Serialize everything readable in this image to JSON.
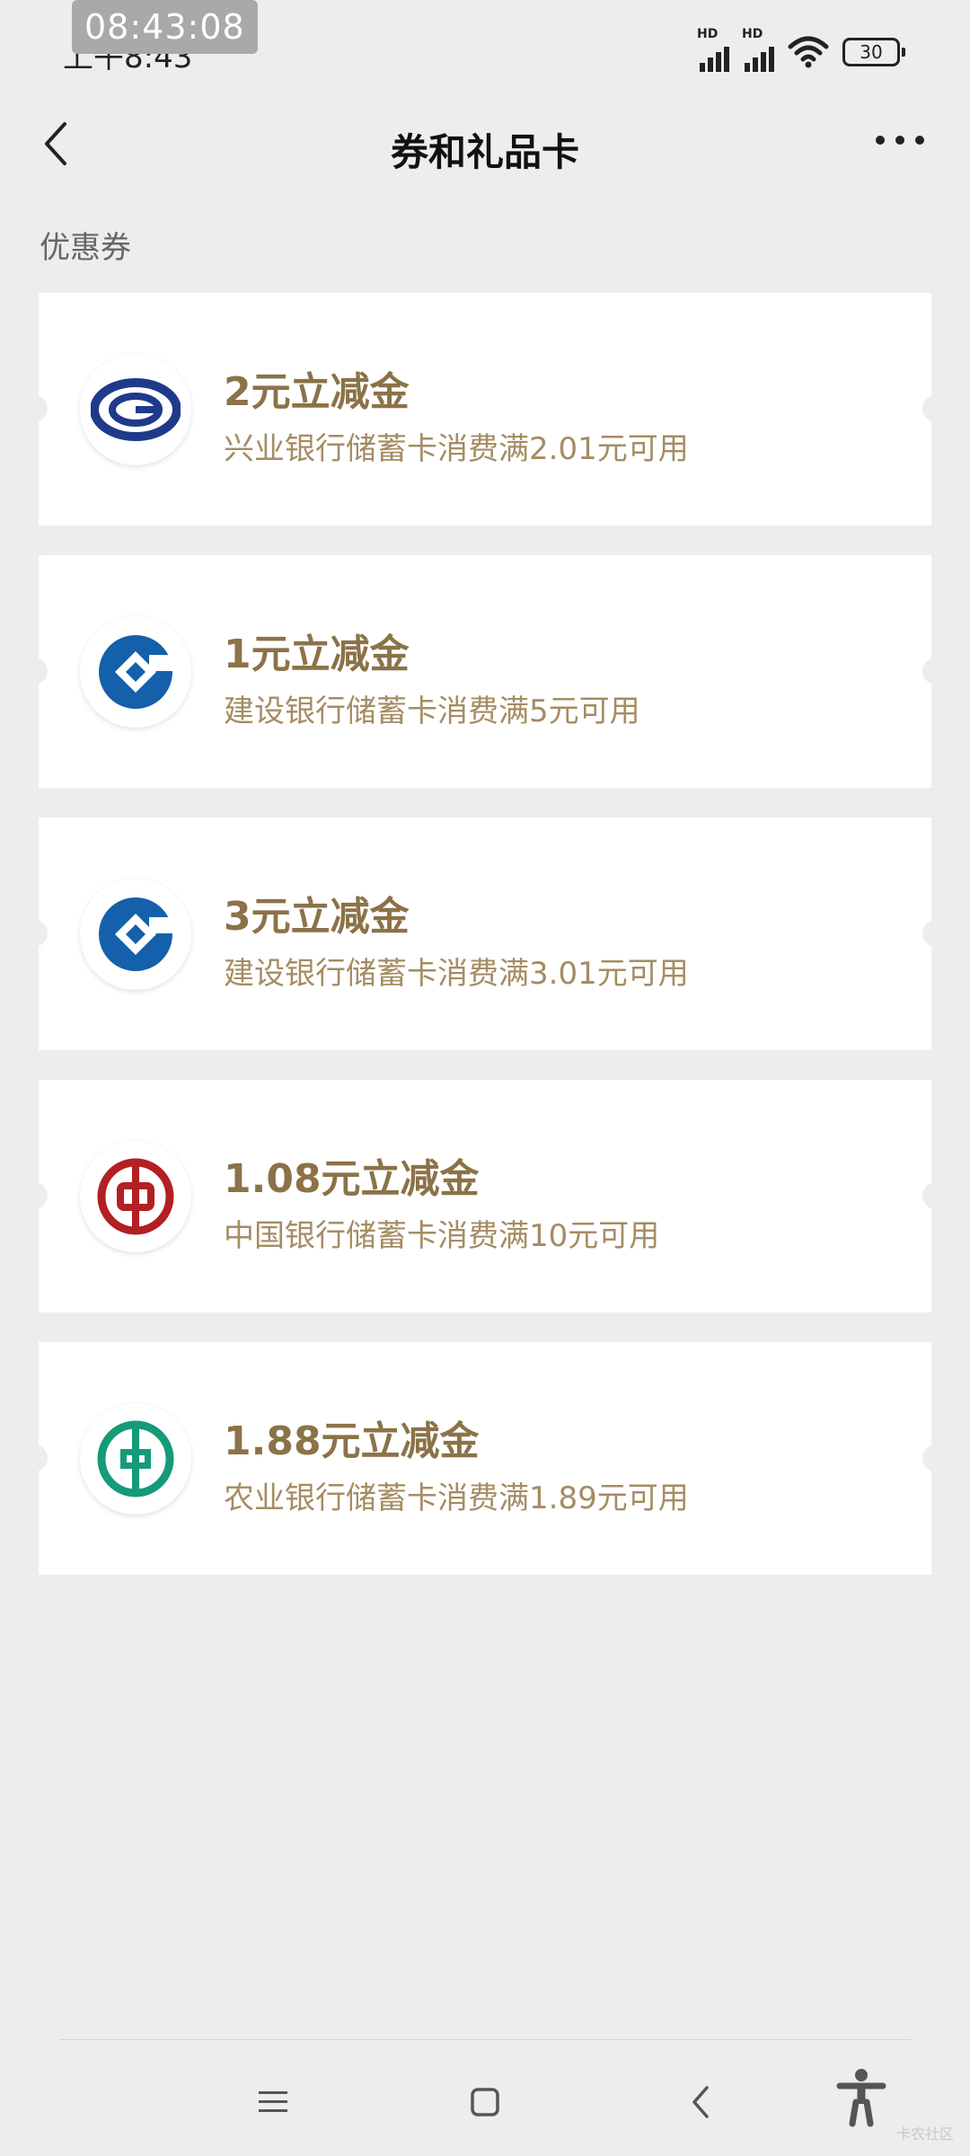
{
  "status_bar": {
    "time_overlay": "08:43:08",
    "time": "上午8:43",
    "signal_badge_1": "HD",
    "signal_badge_2": "HD",
    "battery": "30"
  },
  "nav": {
    "title": "券和礼品卡"
  },
  "section": {
    "label": "优惠券"
  },
  "coupons": [
    {
      "title": "2元立减金",
      "desc": "兴业银行储蓄卡消费满2.01元可用",
      "bank_icon": "cib-bank-logo-icon"
    },
    {
      "title": "1元立减金",
      "desc": "建设银行储蓄卡消费满5元可用",
      "bank_icon": "ccb-bank-logo-icon"
    },
    {
      "title": "3元立减金",
      "desc": "建设银行储蓄卡消费满3.01元可用",
      "bank_icon": "ccb-bank-logo-icon"
    },
    {
      "title": "1.08元立减金",
      "desc": "中国银行储蓄卡消费满10元可用",
      "bank_icon": "boc-bank-logo-icon"
    },
    {
      "title": "1.88元立减金",
      "desc": "农业银行储蓄卡消费满1.89元可用",
      "bank_icon": "abc-bank-logo-icon"
    }
  ],
  "watermark": "卡农社区",
  "colors": {
    "background": "#ededed",
    "card": "#ffffff",
    "title_gold": "#8b7248",
    "desc_gold": "#a58c63",
    "cib_blue": "#1f3a8a",
    "ccb_blue": "#1460aa",
    "boc_red": "#b21f24",
    "abc_green": "#159a7a"
  }
}
